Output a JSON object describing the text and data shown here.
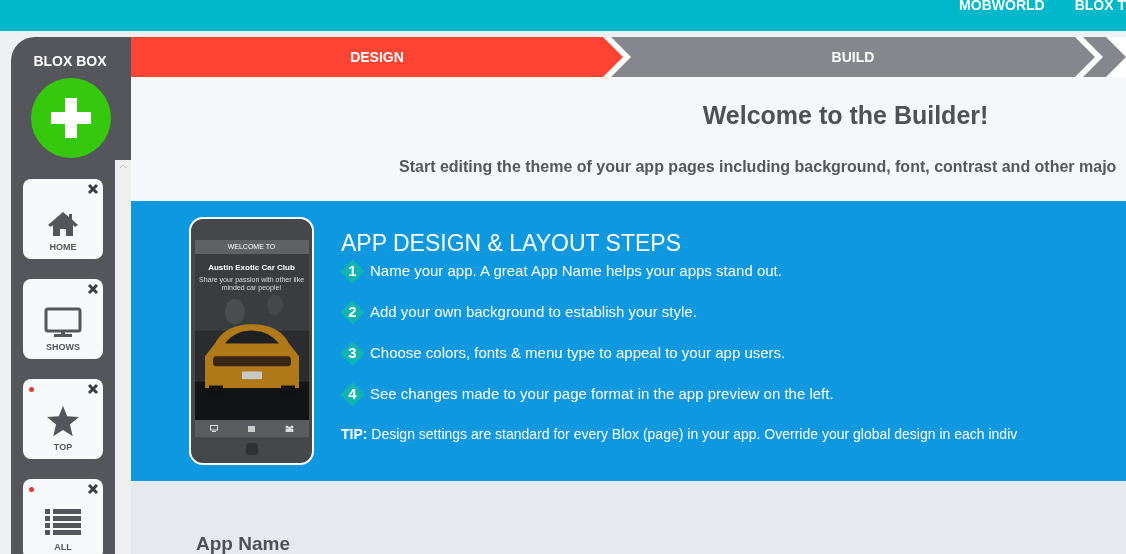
{
  "top_nav": [
    "MOBWORLD",
    "BLOX T"
  ],
  "sidebar": {
    "title": "BLOX BOX",
    "tiles": [
      {
        "label": "HOME",
        "kind": "home",
        "flagged": false
      },
      {
        "label": "SHOWS",
        "kind": "monitor",
        "flagged": false
      },
      {
        "label": "TOP",
        "kind": "star",
        "flagged": true
      },
      {
        "label": "ALL",
        "kind": "list",
        "flagged": true
      }
    ]
  },
  "steps": [
    {
      "label": "DESIGN",
      "selected": true
    },
    {
      "label": "BUILD",
      "selected": false
    },
    {
      "selected": false
    }
  ],
  "welcome": {
    "title": "Welcome to the Builder!",
    "subtitle": "Start editing the theme of your app pages including background, font, contrast and other majo"
  },
  "phone": {
    "header": "WELCOME TO",
    "app_title": "Austin Exotic Car Club",
    "tagline": "Share your passion with other like minded car people!"
  },
  "guide": {
    "title": "APP DESIGN & LAYOUT STEPS",
    "items": [
      {
        "number": "1",
        "text": "Name your app. A great App Name helps your apps stand out."
      },
      {
        "number": "2",
        "text": "Add your own background to establish your style."
      },
      {
        "number": "3",
        "text": "Choose colors, fonts & menu type to appeal to your app users."
      },
      {
        "number": "4",
        "text": "See changes made to your page format in the app preview on the left."
      }
    ],
    "tip": "**TIP:** Design settings are standard for every Blox (page) in your app. Override your global design in each indiv"
  },
  "form": {
    "section_title": "App Name"
  }
}
